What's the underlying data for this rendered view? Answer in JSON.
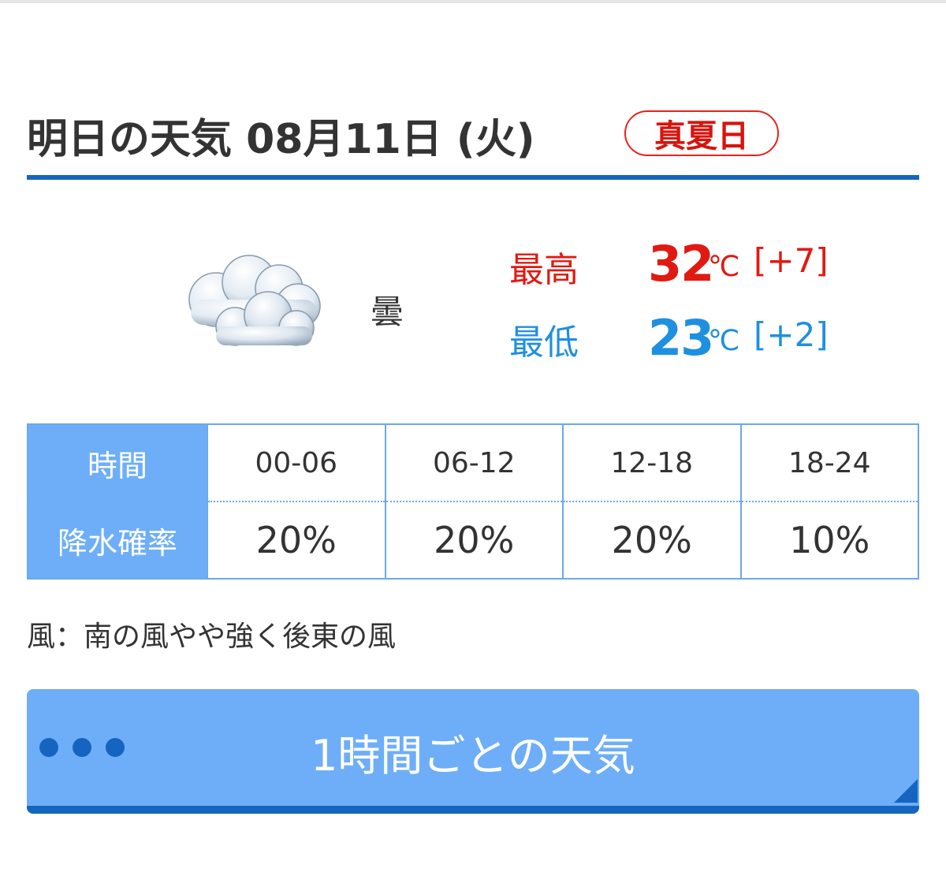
{
  "header": {
    "title": "明日の天気 08月11日 (火)",
    "badge": "真夏日"
  },
  "summary": {
    "icon": "cloud-icon",
    "condition": "曇",
    "high": {
      "label": "最高",
      "value": "32",
      "unit": "℃",
      "diff": "[+7]"
    },
    "low": {
      "label": "最低",
      "value": "23",
      "unit": "℃",
      "diff": "[+2]"
    }
  },
  "forecast": {
    "time_header": "時間",
    "rain_header": "降水確率",
    "periods": [
      "00-06",
      "06-12",
      "12-18",
      "18-24"
    ],
    "rain": [
      "20%",
      "20%",
      "20%",
      "10%"
    ]
  },
  "wind": "風：南の風やや強く後東の風",
  "hourly_button": {
    "label": "1時間ごとの天気"
  },
  "colors": {
    "accent_blue": "#1565c0",
    "button_blue": "#6eaef8",
    "high_red": "#e01a12",
    "low_blue": "#1e90e0"
  }
}
